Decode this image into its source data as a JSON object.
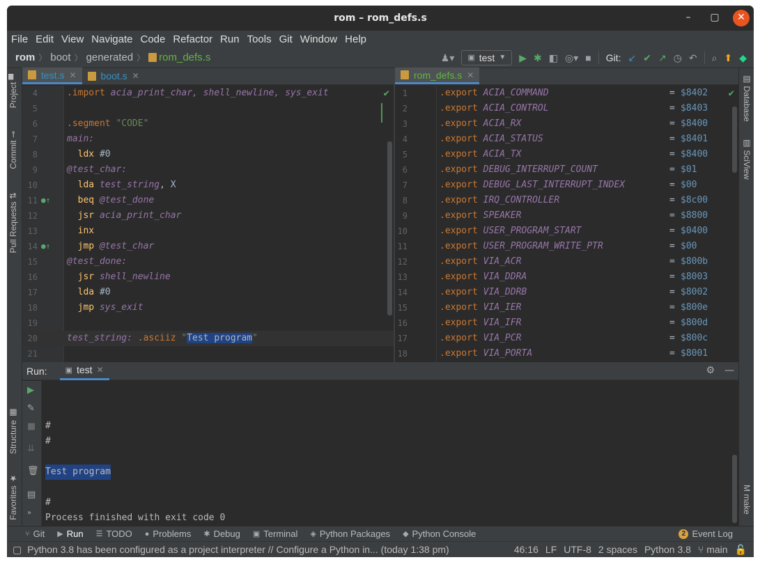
{
  "window": {
    "title": "rom – rom_defs.s"
  },
  "menu": [
    "File",
    "Edit",
    "View",
    "Navigate",
    "Code",
    "Refactor",
    "Run",
    "Tools",
    "Git",
    "Window",
    "Help"
  ],
  "breadcrumb": [
    "rom",
    "boot",
    "generated",
    "rom_defs.s"
  ],
  "toolbar": {
    "run_config": "test",
    "git_label": "Git:"
  },
  "left_tabs": [
    "Project",
    "Commit",
    "Pull Requests",
    "Structure",
    "Favorites"
  ],
  "right_tabs": [
    "Database",
    "SciView",
    "make"
  ],
  "editor_left": {
    "tabs": [
      {
        "label": "test.s",
        "active": true
      },
      {
        "label": "boot.s",
        "active": false
      }
    ],
    "lines": [
      {
        "n": "4",
        "segs": [
          [
            ".import ",
            "dir"
          ],
          [
            "acia_print_char, shell_newline, sys_exit",
            "id"
          ]
        ]
      },
      {
        "n": "5",
        "segs": []
      },
      {
        "n": "6",
        "segs": [
          [
            ".segment ",
            "dir"
          ],
          [
            "\"CODE\"",
            "str"
          ]
        ]
      },
      {
        "n": "7",
        "segs": [
          [
            "main:",
            "id"
          ]
        ]
      },
      {
        "n": "8",
        "segs": [
          [
            "  ldx ",
            "op"
          ],
          [
            "#0",
            "plain"
          ]
        ]
      },
      {
        "n": "9",
        "segs": [
          [
            "@test_char:",
            "id"
          ]
        ]
      },
      {
        "n": "10",
        "segs": [
          [
            "  lda ",
            "op"
          ],
          [
            "test_string",
            "id"
          ],
          [
            ", X",
            "plain"
          ]
        ]
      },
      {
        "n": "11",
        "segs": [
          [
            "  beq ",
            "op"
          ],
          [
            "@test_done",
            "id"
          ]
        ],
        "gicon": true
      },
      {
        "n": "12",
        "segs": [
          [
            "  jsr ",
            "op"
          ],
          [
            "acia_print_char",
            "id"
          ]
        ]
      },
      {
        "n": "13",
        "segs": [
          [
            "  inx",
            "op"
          ]
        ]
      },
      {
        "n": "14",
        "segs": [
          [
            "  jmp ",
            "op"
          ],
          [
            "@test_char",
            "id"
          ]
        ],
        "gicon": true
      },
      {
        "n": "15",
        "segs": [
          [
            "@test_done:",
            "id"
          ]
        ]
      },
      {
        "n": "16",
        "segs": [
          [
            "  jsr ",
            "op"
          ],
          [
            "shell_newline",
            "id"
          ]
        ]
      },
      {
        "n": "17",
        "segs": [
          [
            "  lda ",
            "op"
          ],
          [
            "#0",
            "plain"
          ]
        ]
      },
      {
        "n": "18",
        "segs": [
          [
            "  jmp ",
            "op"
          ],
          [
            "sys_exit",
            "id"
          ]
        ]
      },
      {
        "n": "19",
        "segs": []
      },
      {
        "n": "20",
        "segs": [
          [
            "test_string: ",
            "id"
          ],
          [
            ".asciiz ",
            "dir"
          ],
          [
            "\"",
            "str"
          ],
          [
            "Test program",
            "strhl"
          ],
          [
            "\"",
            "str"
          ]
        ],
        "caret": true
      },
      {
        "n": "21",
        "segs": []
      }
    ]
  },
  "editor_right": {
    "tabs": [
      {
        "label": "rom_defs.s",
        "active": true
      }
    ],
    "lines": [
      {
        "n": "1",
        "name": "ACIA_COMMAND",
        "value": "$8402"
      },
      {
        "n": "2",
        "name": "ACIA_CONTROL",
        "value": "$8403"
      },
      {
        "n": "3",
        "name": "ACIA_RX",
        "value": "$8400"
      },
      {
        "n": "4",
        "name": "ACIA_STATUS",
        "value": "$8401"
      },
      {
        "n": "5",
        "name": "ACIA_TX",
        "value": "$8400"
      },
      {
        "n": "6",
        "name": "DEBUG_INTERRUPT_COUNT",
        "value": "$01"
      },
      {
        "n": "7",
        "name": "DEBUG_LAST_INTERRUPT_INDEX",
        "value": "$00"
      },
      {
        "n": "8",
        "name": "IRQ_CONTROLLER",
        "value": "$8c00"
      },
      {
        "n": "9",
        "name": "SPEAKER",
        "value": "$8800"
      },
      {
        "n": "10",
        "name": "USER_PROGRAM_START",
        "value": "$0400"
      },
      {
        "n": "11",
        "name": "USER_PROGRAM_WRITE_PTR",
        "value": "$00"
      },
      {
        "n": "12",
        "name": "VIA_ACR",
        "value": "$800b"
      },
      {
        "n": "13",
        "name": "VIA_DDRA",
        "value": "$8003"
      },
      {
        "n": "14",
        "name": "VIA_DDRB",
        "value": "$8002"
      },
      {
        "n": "15",
        "name": "VIA_IER",
        "value": "$800e"
      },
      {
        "n": "16",
        "name": "VIA_IFR",
        "value": "$800d"
      },
      {
        "n": "17",
        "name": "VIA_PCR",
        "value": "$800c"
      },
      {
        "n": "18",
        "name": "VIA_PORTA",
        "value": "$8001"
      }
    ],
    "keyword": ".export",
    "eq": "="
  },
  "run": {
    "label": "Run:",
    "tab": "test",
    "console": [
      {
        "text": "",
        "hl": false
      },
      {
        "text": "",
        "hl": false
      },
      {
        "text": "#",
        "hl": false
      },
      {
        "text": "#",
        "hl": false
      },
      {
        "text": "",
        "hl": false
      },
      {
        "text": "Test program",
        "hl": true
      },
      {
        "text": "",
        "hl": false
      },
      {
        "text": "#",
        "hl": false
      },
      {
        "text": "Process finished with exit code 0",
        "hl": false
      }
    ]
  },
  "bottom_tabs": [
    {
      "label": "Git",
      "icon": "git-icon",
      "glyph": "⑂"
    },
    {
      "label": "Run",
      "icon": "run-icon",
      "glyph": "▶",
      "active": true
    },
    {
      "label": "TODO",
      "icon": "todo-icon",
      "glyph": "☰"
    },
    {
      "label": "Problems",
      "icon": "problems-icon",
      "glyph": "●"
    },
    {
      "label": "Debug",
      "icon": "debug-icon",
      "glyph": "✱"
    },
    {
      "label": "Terminal",
      "icon": "terminal-icon",
      "glyph": "▣"
    },
    {
      "label": "Python Packages",
      "icon": "packages-icon",
      "glyph": "◈"
    },
    {
      "label": "Python Console",
      "icon": "python-console-icon",
      "glyph": "◆"
    }
  ],
  "event_log": {
    "label": "Event Log",
    "count": "2"
  },
  "status": {
    "message": "Python 3.8 has been configured as a project interpreter // Configure a Python in... (today 1:38 pm)",
    "position": "46:16",
    "line_sep": "LF",
    "encoding": "UTF-8",
    "indent": "2 spaces",
    "interpreter": "Python 3.8",
    "branch": "main"
  },
  "colors": {
    "accent": "#4a88c7",
    "green": "#62b543",
    "keyword": "#cc7832",
    "identifier": "#9876aa",
    "number": "#6897bb"
  }
}
